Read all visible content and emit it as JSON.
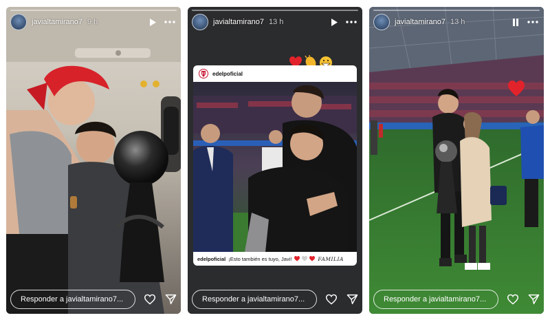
{
  "stories": [
    {
      "username": "javialtamirano7",
      "time": "9 h",
      "play_state": "play",
      "reply_placeholder": "Responder a javialtamirano7..."
    },
    {
      "username": "javialtamirano7",
      "time": "13 h",
      "play_state": "play",
      "reply_placeholder": "Responder a javialtamirano7...",
      "reposted_post": {
        "account": "edelpoficial",
        "caption_account": "edelpoficial",
        "caption_text": "¡Esto también es tuyo, Javi!",
        "caption_tail": "FAMILIA"
      }
    },
    {
      "username": "javialtamirano7",
      "time": "13 h",
      "play_state": "pause",
      "reply_placeholder": "Responder a javialtamirano7..."
    }
  ],
  "colors": {
    "heart": "#e2232b",
    "text": "#ffffff",
    "club_red": "#c8102e"
  }
}
